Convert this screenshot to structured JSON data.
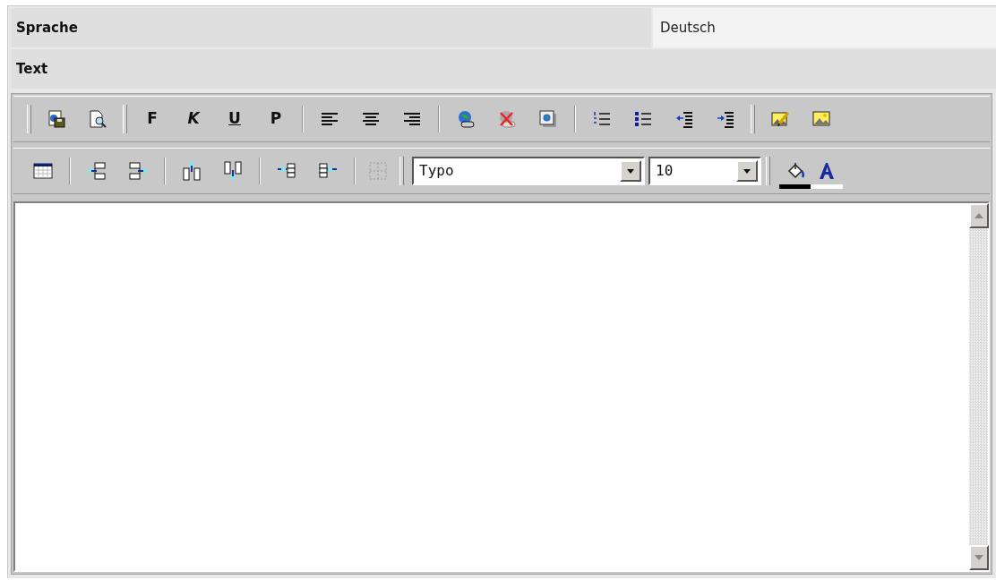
{
  "fields": [
    {
      "label": "Sprache",
      "value": "Deutsch"
    },
    {
      "label": "Text"
    }
  ],
  "editor": {
    "format_buttons": [
      {
        "label": "F"
      },
      {
        "label": "K"
      },
      {
        "label": "U"
      },
      {
        "label": "P"
      }
    ],
    "merge_cells": {
      "disabled": true
    },
    "font_select": {
      "value": "Typo"
    },
    "size_select": {
      "value": "10"
    },
    "color_buttons": [
      {
        "color": "#000000"
      },
      {
        "color": "#ffffff"
      }
    ]
  }
}
